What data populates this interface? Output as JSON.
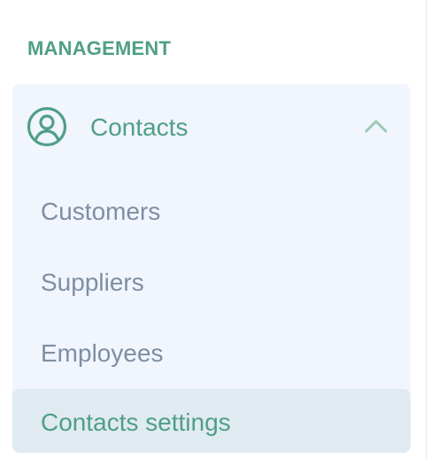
{
  "sidebar": {
    "section_heading": "MANAGEMENT",
    "group": {
      "label": "Contacts",
      "icon": "user-circle-icon",
      "toggle_icon": "chevron-up-icon",
      "expanded": true,
      "items": [
        {
          "label": "Customers",
          "active": false
        },
        {
          "label": "Suppliers",
          "active": false
        },
        {
          "label": "Employees",
          "active": false
        },
        {
          "label": "Contacts settings",
          "active": true
        }
      ]
    }
  },
  "colors": {
    "accent": "#4f9f86",
    "muted_text": "#7f8ea3",
    "group_background": "#f1f5fd",
    "active_background": "#e0eaf1"
  }
}
